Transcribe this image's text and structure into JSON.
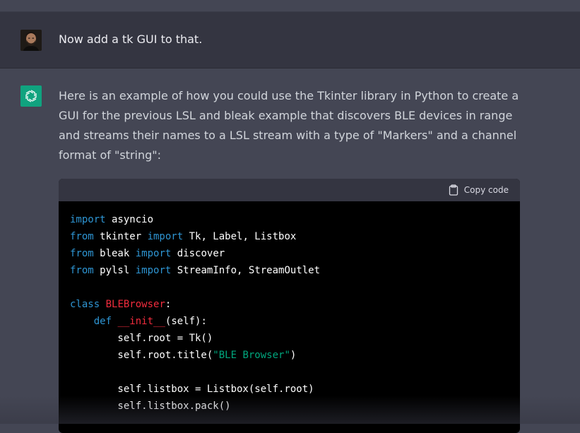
{
  "user_message": {
    "text": "Now add a tk GUI to that."
  },
  "assistant_message": {
    "text": "Here is an example of how you could use the Tkinter library in Python to create a GUI for the previous LSL and bleak example that discovers BLE devices in range and streams their names to a LSL stream with a type of \"Markers\" and a channel format of \"string\":",
    "code_block": {
      "copy_label": "Copy code",
      "lines": [
        [
          {
            "t": "import",
            "c": "kw"
          },
          {
            "t": " asyncio"
          }
        ],
        [
          {
            "t": "from",
            "c": "kw"
          },
          {
            "t": " tkinter "
          },
          {
            "t": "import",
            "c": "kw"
          },
          {
            "t": " Tk, Label, Listbox"
          }
        ],
        [
          {
            "t": "from",
            "c": "kw"
          },
          {
            "t": " bleak "
          },
          {
            "t": "import",
            "c": "kw"
          },
          {
            "t": " discover"
          }
        ],
        [
          {
            "t": "from",
            "c": "kw"
          },
          {
            "t": " pylsl "
          },
          {
            "t": "import",
            "c": "kw"
          },
          {
            "t": " StreamInfo, StreamOutlet"
          }
        ],
        [],
        [
          {
            "t": "class",
            "c": "kw"
          },
          {
            "t": " "
          },
          {
            "t": "BLEBrowser",
            "c": "cls"
          },
          {
            "t": ":"
          }
        ],
        [
          {
            "t": "    "
          },
          {
            "t": "def",
            "c": "kw"
          },
          {
            "t": " "
          },
          {
            "t": "__init__",
            "c": "cls"
          },
          {
            "t": "(self):"
          }
        ],
        [
          {
            "t": "        self.root = Tk()"
          }
        ],
        [
          {
            "t": "        self.root.title("
          },
          {
            "t": "\"BLE Browser\"",
            "c": "str"
          },
          {
            "t": ")"
          }
        ],
        [],
        [
          {
            "t": "        self.listbox = Listbox(self.root)"
          }
        ],
        [
          {
            "t": "        self.listbox.pack()"
          }
        ]
      ]
    }
  },
  "colors": {
    "user_bg": "#343541",
    "assistant_bg": "#444654",
    "code_bg": "#000000",
    "code_header_bg": "#343541",
    "keyword": "#2e95d3",
    "class_name": "#f22c3d",
    "string": "#00a67d",
    "assistant_icon_bg": "#10a37f"
  },
  "icons": {
    "user_avatar": "user-avatar-photo",
    "assistant": "openai-logo-icon",
    "copy": "clipboard-icon"
  }
}
